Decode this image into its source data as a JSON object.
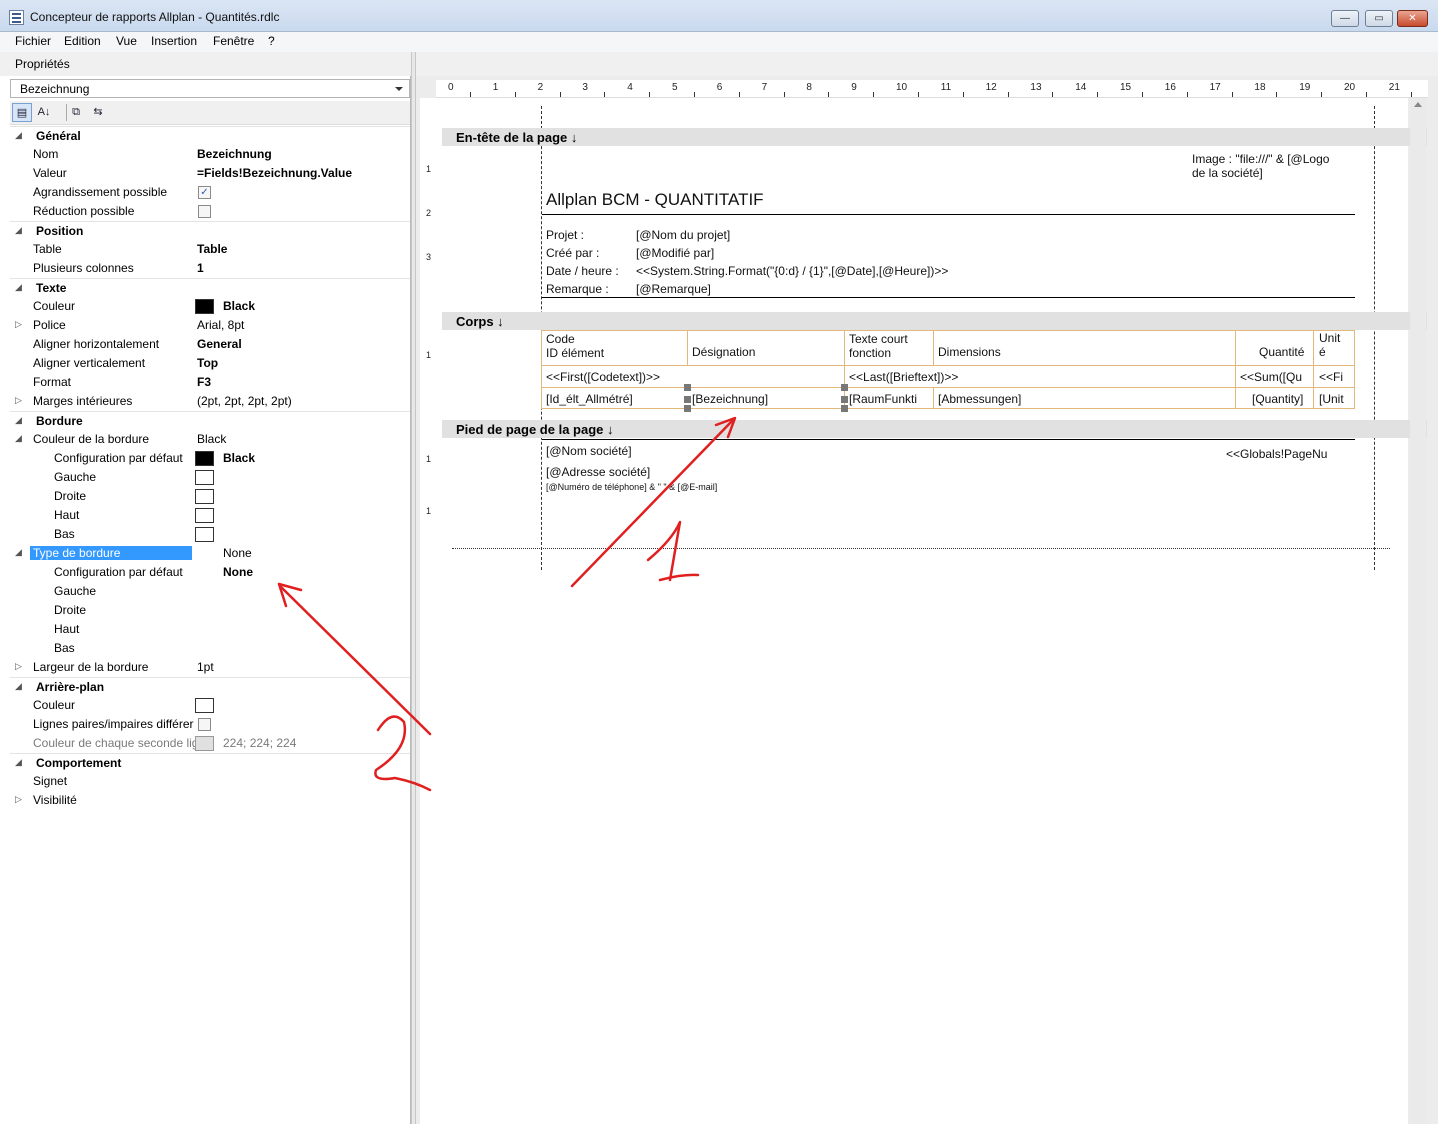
{
  "window": {
    "title": "Concepteur de rapports Allplan - Quantités.rdlc",
    "min_glyph": "—",
    "max_glyph": "▭",
    "close_glyph": "✕"
  },
  "menu": [
    "Fichier",
    "Edition",
    "Vue",
    "Insertion",
    "Fenêtre",
    "?"
  ],
  "properties": {
    "header": "Propriétés",
    "object": "Bezeichnung",
    "toolbar": {
      "categorized": "▤",
      "alpha": "A↓",
      "pages": "⧉",
      "events": "⇆"
    },
    "rows": [
      {
        "type": "cat",
        "name": "Général"
      },
      {
        "type": "prop",
        "name": "Nom",
        "value": "Bezeichnung",
        "bold": true
      },
      {
        "type": "prop",
        "name": "Valeur",
        "value": "=Fields!Bezeichnung.Value",
        "bold": true
      },
      {
        "type": "prop",
        "name": "Agrandissement possible",
        "check": true
      },
      {
        "type": "prop",
        "name": "Réduction possible",
        "check": false
      },
      {
        "type": "cat",
        "name": "Position"
      },
      {
        "type": "prop",
        "name": "Table",
        "value": "Table",
        "bold": true
      },
      {
        "type": "prop",
        "name": "Plusieurs colonnes",
        "value": "1",
        "bold": true
      },
      {
        "type": "cat",
        "name": "Texte"
      },
      {
        "type": "prop",
        "name": "Couleur",
        "swatch": "#000000",
        "value": "Black",
        "bold": true
      },
      {
        "type": "prop",
        "name": "Police",
        "value": "Arial, 8pt",
        "expand": "collapsed"
      },
      {
        "type": "prop",
        "name": "Aligner horizontalement",
        "value": "General",
        "bold": true
      },
      {
        "type": "prop",
        "name": "Aligner verticalement",
        "value": "Top",
        "bold": true
      },
      {
        "type": "prop",
        "name": "Format",
        "value": "F3",
        "bold": true
      },
      {
        "type": "prop",
        "name": "Marges intérieures",
        "value": "(2pt, 2pt, 2pt, 2pt)",
        "expand": "collapsed"
      },
      {
        "type": "cat",
        "name": "Bordure"
      },
      {
        "type": "prop",
        "name": "Couleur de la bordure",
        "value": "Black",
        "expand": "expanded"
      },
      {
        "type": "sub",
        "name": "Configuration par défaut",
        "swatch": "#000000",
        "value": "Black",
        "bold": true
      },
      {
        "type": "sub",
        "name": "Gauche",
        "swatch": "#ffffff"
      },
      {
        "type": "sub",
        "name": "Droite",
        "swatch": "#ffffff"
      },
      {
        "type": "sub",
        "name": "Haut",
        "swatch": "#ffffff"
      },
      {
        "type": "sub",
        "name": "Bas",
        "swatch": "#ffffff"
      },
      {
        "type": "prop",
        "name": "Type de bordure",
        "value": "None",
        "selected": true,
        "expand": "expanded",
        "valindent": true
      },
      {
        "type": "sub",
        "name": "Configuration par défaut",
        "value": "None",
        "bold": true,
        "valindent": true
      },
      {
        "type": "sub",
        "name": "Gauche"
      },
      {
        "type": "sub",
        "name": "Droite"
      },
      {
        "type": "sub",
        "name": "Haut"
      },
      {
        "type": "sub",
        "name": "Bas"
      },
      {
        "type": "prop",
        "name": "Largeur de la bordure",
        "value": "1pt",
        "expand": "collapsed"
      },
      {
        "type": "cat",
        "name": "Arrière-plan"
      },
      {
        "type": "prop",
        "name": "Couleur",
        "swatch": "#ffffff"
      },
      {
        "type": "prop",
        "name": "Lignes paires/impaires différer",
        "check": false
      },
      {
        "type": "prop",
        "name": "Couleur de chaque seconde lig",
        "swatch": "#e0e0e0",
        "value": "224; 224; 224",
        "gray": true
      },
      {
        "type": "cat",
        "name": "Comportement"
      },
      {
        "type": "prop",
        "name": "Signet"
      },
      {
        "type": "prop",
        "name": "Visibilité",
        "expand": "collapsed"
      }
    ]
  },
  "ruler": [
    "0",
    "1",
    "2",
    "3",
    "4",
    "5",
    "6",
    "7",
    "8",
    "9",
    "10",
    "11",
    "12",
    "13",
    "14",
    "15",
    "16",
    "17",
    "18",
    "19",
    "20",
    "21"
  ],
  "vruler": [
    "1",
    "2",
    "3",
    "1",
    "1",
    "1"
  ],
  "report": {
    "header_band": "En-tête de la page ↓",
    "image_text_1": "Image : \"file:///\" & [@Logo",
    "image_text_2": "de la société]",
    "title": "Allplan BCM - QUANTITATIF",
    "info": [
      {
        "label": "Projet :",
        "value": "[@Nom du projet]"
      },
      {
        "label": "Créé par :",
        "value": "[@Modifié par]"
      },
      {
        "label": "Date / heure :",
        "value": "<<System.String.Format(\"{0:d} / {1}\",[@Date],[@Heure])>>"
      },
      {
        "label": "Remarque :",
        "value": "[@Remarque]"
      }
    ],
    "body_band": "Corps ↓",
    "table_headers": {
      "code_1": "Code",
      "code_2": "ID élément",
      "designation": "Désignation",
      "texte_1": "Texte court",
      "texte_2": "fonction",
      "dimensions": "Dimensions",
      "quantite": "Quantité",
      "unit_1": "Unit",
      "unit_2": "é"
    },
    "group_row": {
      "first": "<<First([Codetext])>>",
      "last": "<<Last([Brieftext])>>",
      "sum": "<<Sum([Qu",
      "fi": "<<Fi"
    },
    "detail_row": {
      "id": "[Id_élt_Allmétré]",
      "bez": "[Bezeichnung]",
      "raum": "[RaumFunkti",
      "abm": "[Abmessungen]",
      "qty": "[Quantity]",
      "unit": "[Unit"
    },
    "footer_band": "Pied de page de la page ↓",
    "footer": {
      "company": "[@Nom société]",
      "address": "[@Adresse société]",
      "phone": "[@Numéro de téléphone] & \"  \" & [@E-mail]",
      "page": "<<Globals!PageNu"
    }
  },
  "colors": {
    "selection": "#3399ff",
    "annotation": "#e02020",
    "table_border": "#e1b87a"
  }
}
